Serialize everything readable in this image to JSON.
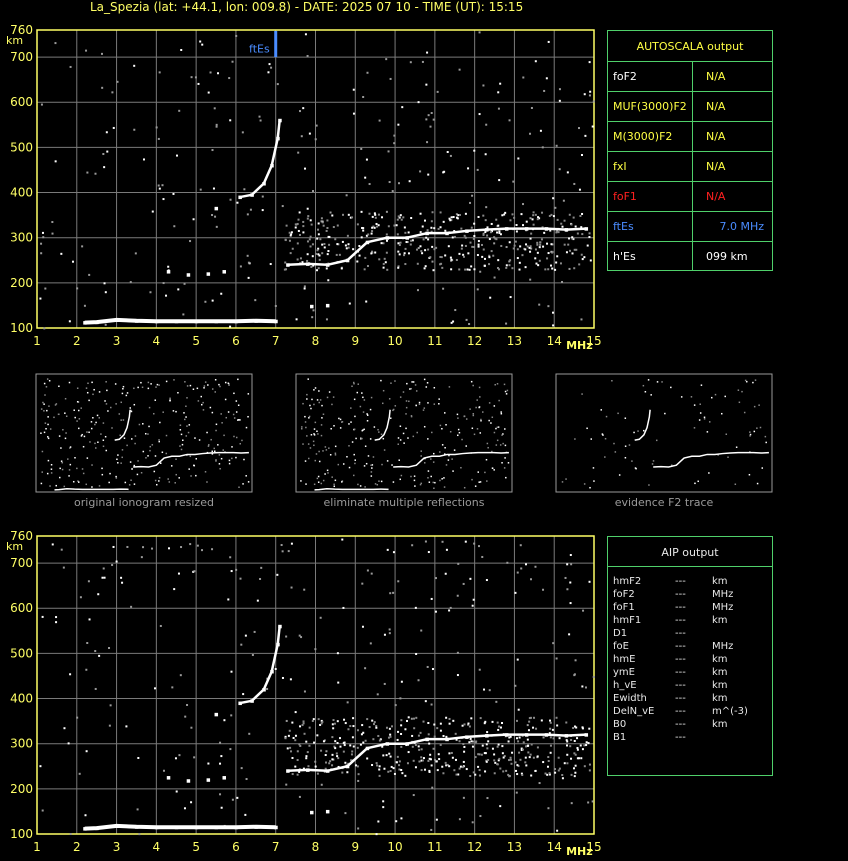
{
  "header": {
    "title": "La_Spezia (lat: +44.1, lon: 009.8) - DATE: 2025 07 10 - TIME (UT): 15:15"
  },
  "autoscala": {
    "title": "AUTOSCALA output",
    "rows": [
      {
        "label": "foF2",
        "value": "N/A",
        "label_color": "#ffffff",
        "value_color": "#ffff44"
      },
      {
        "label": "MUF(3000)F2",
        "value": "N/A",
        "label_color": "#ffff44",
        "value_color": "#ffff44"
      },
      {
        "label": "M(3000)F2",
        "value": "N/A",
        "label_color": "#ffff44",
        "value_color": "#ffff44"
      },
      {
        "label": "fxI",
        "value": "N/A",
        "label_color": "#ffff44",
        "value_color": "#ffff44"
      },
      {
        "label": "foF1",
        "value": "N/A",
        "label_color": "#ff2020",
        "value_color": "#ff2020"
      },
      {
        "label": "ftEs",
        "value": "7.0 MHz",
        "label_color": "#4a8cff",
        "value_color": "#4a8cff"
      },
      {
        "label": "h'Es",
        "value": "099     km",
        "label_color": "#ffffff",
        "value_color": "#ffffff"
      }
    ]
  },
  "aip": {
    "title": "AIP output",
    "rows": [
      {
        "param": "hmF2",
        "value": "---",
        "unit": "km"
      },
      {
        "param": "foF2",
        "value": "---",
        "unit": "MHz"
      },
      {
        "param": "foF1",
        "value": "---",
        "unit": "MHz"
      },
      {
        "param": "hmF1",
        "value": "---",
        "unit": "km"
      },
      {
        "param": "D1",
        "value": "---",
        "unit": ""
      },
      {
        "param": "foE",
        "value": "---",
        "unit": "MHz"
      },
      {
        "param": "hmE",
        "value": "---",
        "unit": "km"
      },
      {
        "param": "ymE",
        "value": "---",
        "unit": "km"
      },
      {
        "param": "h_vE",
        "value": "---",
        "unit": "km"
      },
      {
        "param": "Ewidth",
        "value": "---",
        "unit": "km"
      },
      {
        "param": "DelN_vE",
        "value": "---",
        "unit": "m^(-3)"
      },
      {
        "param": "B0",
        "value": "---",
        "unit": "km"
      },
      {
        "param": "B1",
        "value": "---",
        "unit": ""
      }
    ]
  },
  "thumbnails": [
    {
      "caption": "original ionogram resized"
    },
    {
      "caption": "eliminate multiple reflections"
    },
    {
      "caption": "evidence F2 trace"
    }
  ],
  "chart_data": [
    {
      "type": "scatter",
      "title": "",
      "xlabel": "MHz",
      "ylabel": "km",
      "xlim": [
        1,
        15
      ],
      "ylim": [
        100,
        760
      ],
      "x_ticks": [
        "1",
        "2",
        "3",
        "4",
        "5",
        "6",
        "7",
        "8",
        "9",
        "10",
        "11",
        "12",
        "13",
        "14",
        "15"
      ],
      "y_ticks": [
        "100",
        "200",
        "300",
        "400",
        "500",
        "600",
        "700",
        "760"
      ],
      "grid": true,
      "annotation": {
        "label": "ftEs",
        "x": 7.0,
        "color": "#4a8cff"
      },
      "series": [
        {
          "values": [
            [
              2.2,
              112
            ],
            [
              2.5,
              113
            ],
            [
              3,
              118
            ],
            [
              3.5,
              116
            ],
            [
              4,
              115
            ],
            [
              4.5,
              115
            ],
            [
              5,
              115
            ],
            [
              5.5,
              115
            ],
            [
              6,
              115
            ],
            [
              6.5,
              116
            ],
            [
              7,
              115
            ]
          ]
        },
        {
          "values": [
            [
              6.1,
              390
            ],
            [
              6.4,
              395
            ],
            [
              6.7,
              420
            ],
            [
              6.9,
              460
            ],
            [
              7.05,
              520
            ],
            [
              7.1,
              560
            ]
          ]
        },
        {
          "values": [
            [
              7.3,
              240
            ],
            [
              7.8,
              242
            ],
            [
              8.3,
              240
            ],
            [
              8.8,
              250
            ],
            [
              9.3,
              290
            ],
            [
              9.8,
              300
            ],
            [
              10.3,
              300
            ],
            [
              10.8,
              310
            ],
            [
              11.3,
              310
            ],
            [
              11.8,
              315
            ],
            [
              12.3,
              318
            ],
            [
              12.8,
              320
            ],
            [
              13.3,
              320
            ],
            [
              13.8,
              320
            ],
            [
              14.3,
              318
            ],
            [
              14.8,
              320
            ]
          ]
        },
        {
          "values": [
            [
              5.5,
              365
            ],
            [
              7.9,
              148
            ],
            [
              8.3,
              150
            ],
            [
              4.3,
              225
            ],
            [
              4.8,
              218
            ],
            [
              5.3,
              220
            ],
            [
              5.7,
              225
            ]
          ]
        }
      ]
    },
    {
      "type": "scatter",
      "title": "",
      "xlabel": "MHz",
      "ylabel": "km",
      "xlim": [
        1,
        15
      ],
      "ylim": [
        100,
        760
      ],
      "x_ticks": [
        "1",
        "2",
        "3",
        "4",
        "5",
        "6",
        "7",
        "8",
        "9",
        "10",
        "11",
        "12",
        "13",
        "14",
        "15"
      ],
      "y_ticks": [
        "100",
        "200",
        "300",
        "400",
        "500",
        "600",
        "700",
        "760"
      ],
      "grid": true,
      "series": [
        {
          "values": [
            [
              2.2,
              112
            ],
            [
              2.5,
              113
            ],
            [
              3,
              118
            ],
            [
              3.5,
              116
            ],
            [
              4,
              115
            ],
            [
              4.5,
              115
            ],
            [
              5,
              115
            ],
            [
              5.5,
              115
            ],
            [
              6,
              115
            ],
            [
              6.5,
              116
            ],
            [
              7,
              115
            ]
          ]
        },
        {
          "values": [
            [
              6.1,
              390
            ],
            [
              6.4,
              395
            ],
            [
              6.7,
              420
            ],
            [
              6.9,
              460
            ],
            [
              7.05,
              520
            ],
            [
              7.1,
              560
            ]
          ]
        },
        {
          "values": [
            [
              7.3,
              240
            ],
            [
              7.8,
              242
            ],
            [
              8.3,
              240
            ],
            [
              8.8,
              250
            ],
            [
              9.3,
              290
            ],
            [
              9.8,
              300
            ],
            [
              10.3,
              300
            ],
            [
              10.8,
              310
            ],
            [
              11.3,
              310
            ],
            [
              11.8,
              315
            ],
            [
              12.3,
              318
            ],
            [
              12.8,
              320
            ],
            [
              13.3,
              320
            ],
            [
              13.8,
              320
            ],
            [
              14.3,
              318
            ],
            [
              14.8,
              320
            ]
          ]
        },
        {
          "values": [
            [
              5.5,
              365
            ],
            [
              7.9,
              148
            ],
            [
              8.3,
              150
            ],
            [
              4.3,
              225
            ],
            [
              4.8,
              218
            ],
            [
              5.3,
              220
            ],
            [
              5.7,
              225
            ]
          ]
        }
      ]
    }
  ]
}
